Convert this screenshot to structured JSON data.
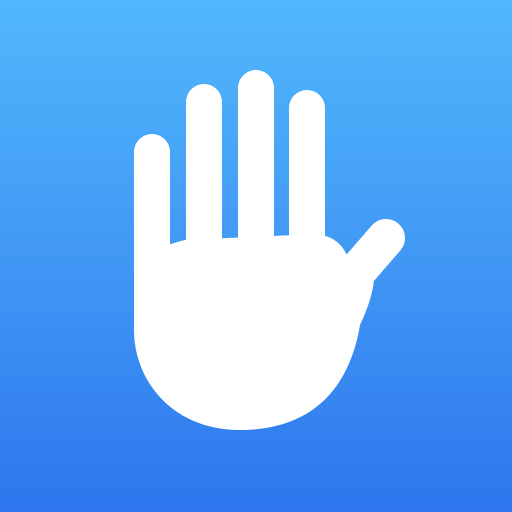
{
  "icon": {
    "name": "hand-icon",
    "colors": {
      "gradient_top": "#51b8fc",
      "gradient_mid": "#3f95f4",
      "gradient_bottom": "#2d76ee",
      "glyph": "#ffffff"
    }
  }
}
